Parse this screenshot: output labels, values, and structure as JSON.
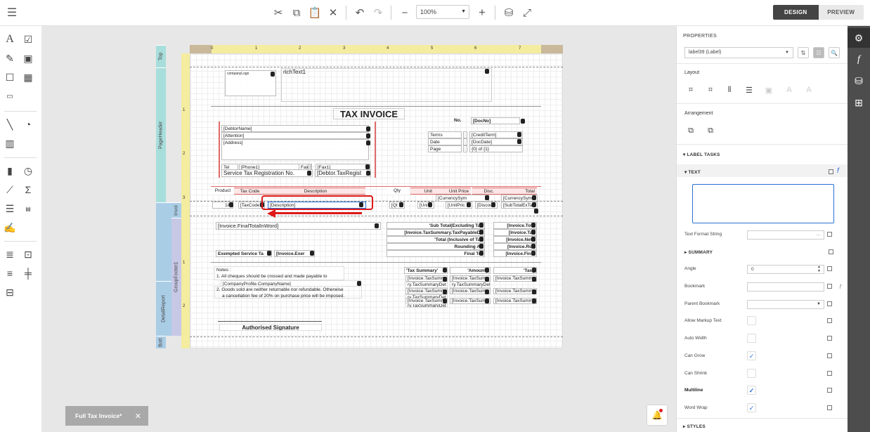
{
  "toolbar": {
    "zoom_value": "100%",
    "design_label": "DESIGN",
    "preview_label": "PREVIEW"
  },
  "report": {
    "bands": [
      "Top",
      "PageHeader",
      "Invoi",
      "DetailReport",
      "GroupFooter1",
      "Bott"
    ],
    "vruler_marks": [
      "1",
      "2",
      "3",
      "1",
      "2"
    ],
    "hruler_marks": [
      "0",
      "1",
      "2",
      "3",
      "4",
      "5",
      "6",
      "7"
    ],
    "company_logo": "companyLogo",
    "rich_text": "richText1",
    "title": "TAX INVOICE",
    "no_label": "No.",
    "doc_no": "[DocNo]",
    "debtor_name": "[DebtorName]",
    "attention": "[Attention]",
    "address": "[Address]",
    "terms_label": "Terms",
    "date_label": "Date",
    "page_label": "Page",
    "colon": ":",
    "credit_term": "[CreditTerm]",
    "doc_date": "[DocDate]",
    "page_fmt": "{0} of {1}",
    "tel_label": "Tel",
    "phone1": "[Phone1]",
    "fax_label": "Fax",
    "fax1": "[Fax1]",
    "str_label": "Service Tax Registration No.",
    "debtor_taxreg": "[Debtor.TaxRegist",
    "col_product": "Product",
    "col_taxcode": "Tax Code",
    "col_description": "Description",
    "col_qty": "Qty",
    "col_unit": "Unit",
    "col_unitprice": "Unit Price",
    "col_disc": "Disc.",
    "col_total": "Total",
    "currency_sym": "[CurrencySym",
    "row_code": "1if(",
    "row_taxcode": "[TaxCode",
    "row_description": "[Description]",
    "row_qty": "[Qt",
    "row_unit": "[Uni",
    "row_unitprice": "[UnitPric",
    "row_disc": "[Discou",
    "row_subtotal": "[SubTotalExTa",
    "final_total_word": "[Invoice.FinalTotalInWord]",
    "sub_total_excl": "'Sub Total(Excluding Tax",
    "inv_total1": "[Invoice.Tota",
    "tax_payable": "[Invoice.TaxSummary.TaxPayableDe",
    "inv_tax": "[Invoice.Tax",
    "total_incl": "'Total (Inclusive of Tax",
    "inv_nett": "[Invoice.NetT",
    "rounding": "Rounding Ad",
    "inv_round": "[Invoice.Rou",
    "final_tot": "Final Tot",
    "inv_final": "[Invoice.Final",
    "exempted": "Exempted Service Ta",
    "inv_exem": "[Invoice.Exer",
    "notes_label": "Notes :",
    "note1": "1. All cheques should be crossed and made payable to",
    "company_name": "[CompanyProfile.CompanyName]",
    "note2a": "2. Goods sold are neither returnable nor refundable. Otherwise",
    "note2b": "a cancellation fee of 20% on purchase price will be imposed.",
    "tax_summary": "'Tax Summary'",
    "amount": "'Amount('",
    "tax_h": "'Tax('",
    "ts_cell1": "[Invoice.TaxSumm",
    "ts_cell2": "[Invoice.TaxSumm",
    "ts_cell3": "[Invoice.TaxSumm",
    "ts_cell4": "[Invoice.TaxSumm",
    "ts_sub1": "ry.TaxSummaryDet",
    "ts_sub2": "ry.TaxSummaryDet",
    "ts_sub3": "ry.TaxSummaryDet",
    "ts_sub4": "ry.TaxSummaryDet",
    "ts_amt1": "[Invoice.TaxSumn",
    "ts_amt2": "[Invoice.TaxSumn",
    "ts_amt3": "[Invoice.TaxSumn",
    "ts_amt4": "[Invoice.TaxSumn",
    "ts_tax1": "[Invoice.TaxSumm",
    "ts_tax2": "[Invoice.TaxSumm",
    "ts_tax3": "[Invoice.TaxSumm",
    "ts_tax4": "[Invoice.TaxSumm",
    "signature": "Authorised Signature"
  },
  "properties": {
    "title": "PROPERTIES",
    "selected": "label39 (Label)",
    "layout_label": "Layout",
    "arrangement_label": "Arrangement",
    "label_tasks": "LABEL TASKS",
    "text_section": "TEXT",
    "text_format_label": "Text Format String",
    "text_format_value": "···",
    "summary_section": "SUMMARY",
    "angle_label": "Angle",
    "angle_value": "0",
    "bookmark_label": "Bookmark",
    "parent_bookmark_label": "Parent Bookmark",
    "allow_markup_label": "Allow Markup Text",
    "auto_width_label": "Auto Width",
    "can_grow_label": "Can Grow",
    "can_shrink_label": "Can Shrink",
    "multiline_label": "Multiline",
    "word_wrap_label": "Word Wrap",
    "styles_section": "STYLES",
    "checkmark": "✓"
  },
  "document_tab": {
    "label": "Full Tax Invoice*",
    "close": "✕"
  },
  "colors": {
    "accent": "#2a6fd6",
    "rail": "#4d4d4d",
    "band_top": "#a7dedb",
    "band_detail": "#aacde6",
    "band_footer": "#c7c7e6",
    "selection_red": "#e01818"
  }
}
